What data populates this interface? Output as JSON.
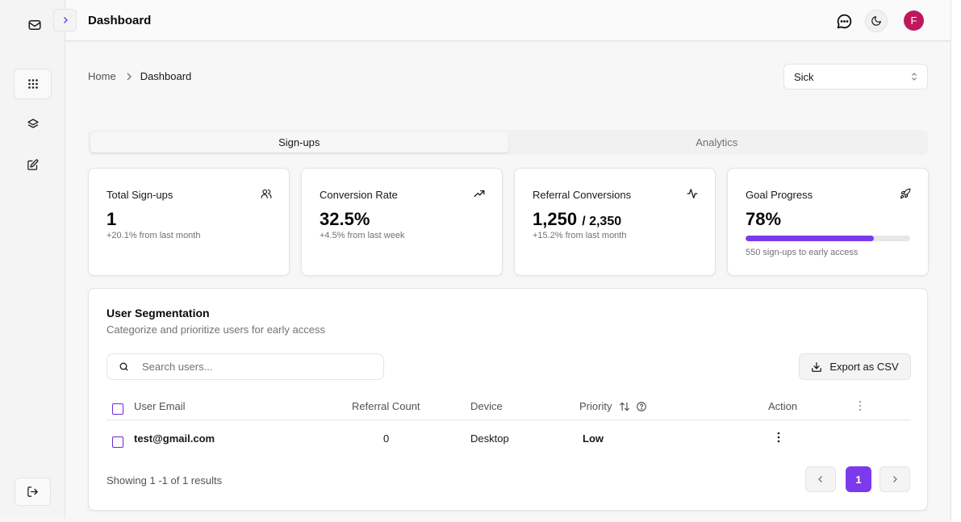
{
  "header": {
    "title": "Dashboard",
    "avatar_initial": "F"
  },
  "breadcrumb": {
    "home": "Home",
    "current": "Dashboard"
  },
  "filter_select": {
    "value": "Sick"
  },
  "tabs": [
    {
      "label": "Sign-ups",
      "active": true
    },
    {
      "label": "Analytics",
      "active": false
    }
  ],
  "stats": [
    {
      "title": "Total Sign-ups",
      "value": "1",
      "sub": "+20.1% from last month",
      "icon": "users-icon"
    },
    {
      "title": "Conversion Rate",
      "value": "32.5%",
      "sub": "+4.5% from last week",
      "icon": "trending-up-icon"
    },
    {
      "title": "Referral Conversions",
      "value": "1,250",
      "denominator": "/ 2,350",
      "sub": "+15.2% from last month",
      "icon": "activity-icon"
    },
    {
      "title": "Goal Progress",
      "value": "78%",
      "progress": 0.78,
      "sub": "550 sign-ups to early access",
      "icon": "rocket-icon"
    }
  ],
  "segmentation": {
    "title": "User Segmentation",
    "description": "Categorize and prioritize users for early access",
    "search_placeholder": "Search users...",
    "export_label": "Export as CSV",
    "columns": [
      "User Email",
      "Referral Count",
      "Device",
      "Priority",
      "Action"
    ],
    "rows": [
      {
        "email": "test@gmail.com",
        "referral_count": "0",
        "device": "Desktop",
        "priority": "Low"
      }
    ],
    "footer": "Showing 1 -1 of 1 results",
    "current_page": "1"
  },
  "colors": {
    "accent": "#7c3aed",
    "avatar": "#be185d"
  }
}
